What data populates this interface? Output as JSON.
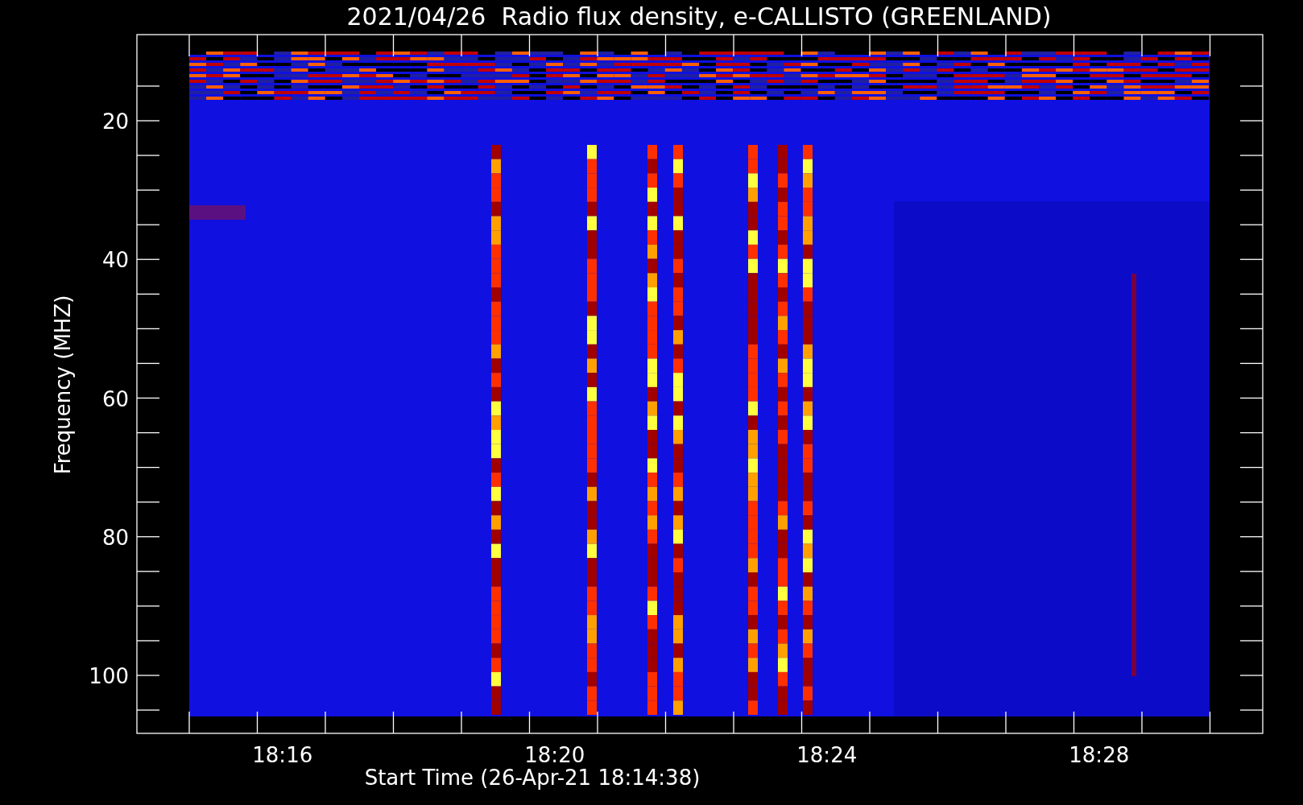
{
  "title": "2021/04/26  Radio flux density, e-CALLISTO (GREENLAND)",
  "y_axis": {
    "label": "Frequency (MHZ)",
    "ticks": [
      "20",
      "40",
      "60",
      "80",
      "100"
    ]
  },
  "x_axis": {
    "label": "Start Time (26-Apr-21 18:14:38)",
    "ticks": [
      "18:16",
      "18:20",
      "18:24",
      "18:28"
    ]
  }
}
